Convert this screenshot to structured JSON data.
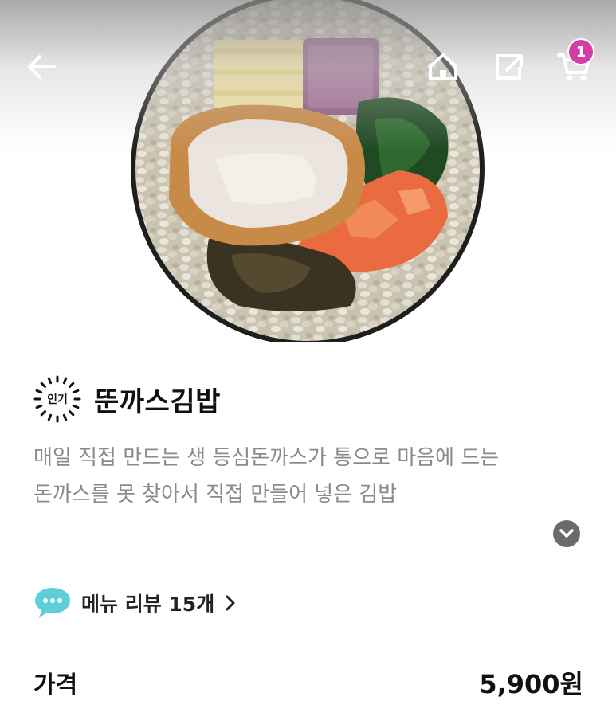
{
  "header": {
    "cart_count": "1",
    "icons": {
      "back": "back-arrow-icon",
      "home": "home-icon",
      "share": "share-icon",
      "cart": "cart-icon"
    }
  },
  "product": {
    "badge_label": "인기",
    "name": "뚠까스김밥",
    "description": "매일 직접 만드는 생 등심돈까스가 통으로 마음에 드는 돈까스를 못 찾아서 직접 만들어 넣은 김밥",
    "expand_icon": "chevron-down-icon"
  },
  "review": {
    "label": "메뉴 리뷰 15개",
    "icon": "speech-bubble-icon",
    "accent_color": "#5ecfd8"
  },
  "price": {
    "label": "가격",
    "value": "5,900원"
  },
  "theme": {
    "badge_color": "#d63ca6"
  }
}
